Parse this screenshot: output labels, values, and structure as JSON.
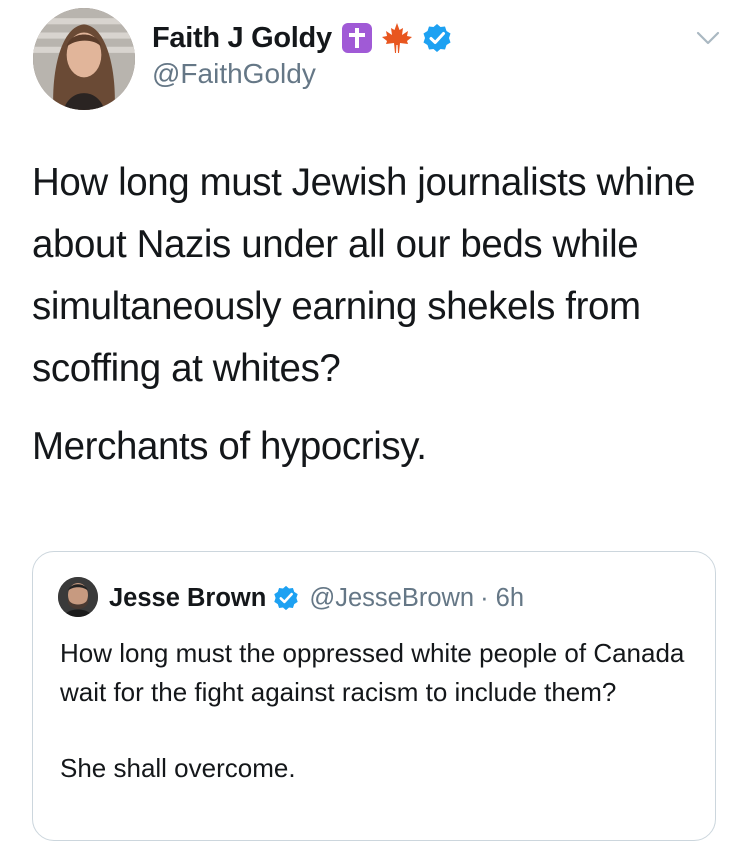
{
  "tweet": {
    "author": {
      "display_name": "Faith J Goldy",
      "handle": "@FaithGoldy",
      "name_emojis": [
        "latin-cross",
        "maple-leaf"
      ],
      "verified": true
    },
    "menu_icon": "chevron-down-icon",
    "text_paragraphs": [
      "How long must Jewish journalists whine about Nazis under all our beds while simultaneously earning shekels from scoffing at whites?",
      "Merchants of hypocrisy."
    ]
  },
  "quoted_tweet": {
    "author": {
      "display_name": "Jesse Brown",
      "handle": "@JesseBrown",
      "verified": true
    },
    "meta": "· 6h",
    "text_paragraphs": [
      "How long must the oppressed white people of Canada wait for the fight against racism to include them?",
      "She shall overcome."
    ]
  },
  "colors": {
    "text_primary": "#14171a",
    "text_secondary": "#657786",
    "verified_blue": "#1da1f2",
    "border": "#ccd6dd",
    "cross_emoji_bg": "#a05ad6",
    "maple_leaf": "#e8561f"
  }
}
